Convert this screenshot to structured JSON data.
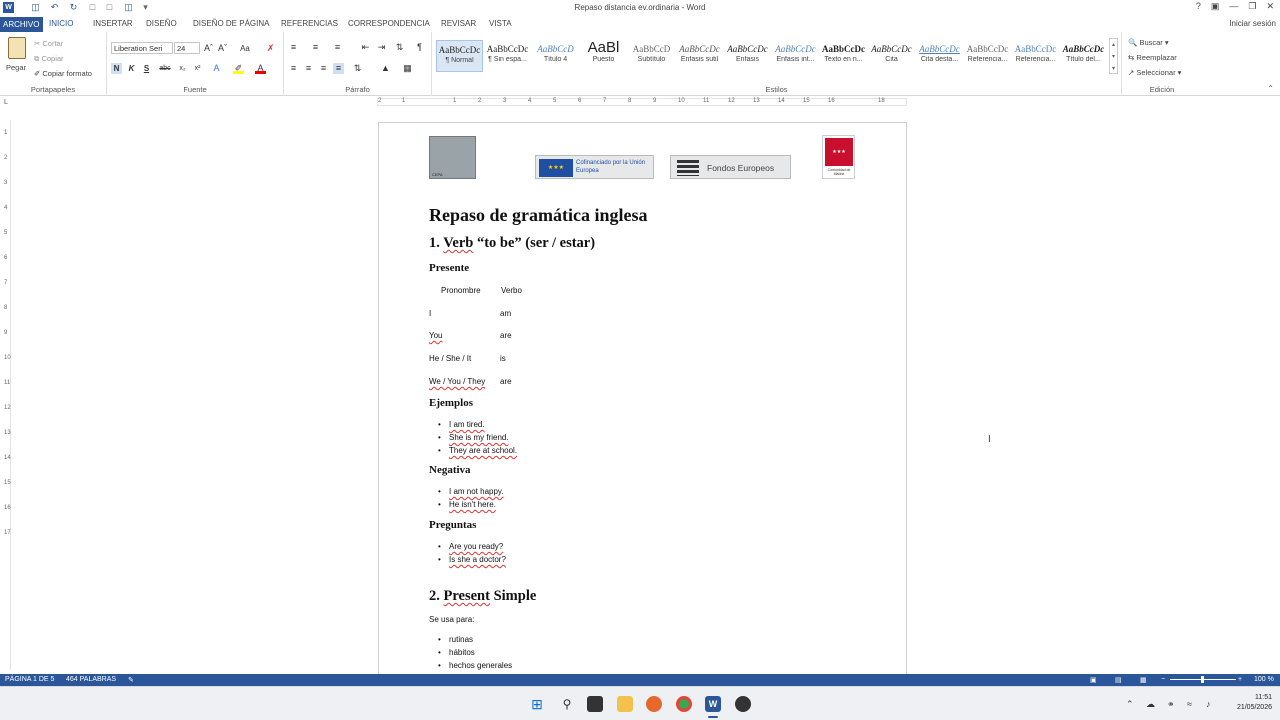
{
  "window": {
    "title": "Repaso distancia ev.ordinaria - Word",
    "help": "?",
    "signin": "Iniciar sesión"
  },
  "tabs": [
    {
      "label": "ARCHIVO"
    },
    {
      "label": "INICIO"
    },
    {
      "label": "INSERTAR"
    },
    {
      "label": "DISEÑO"
    },
    {
      "label": "DISEÑO DE PÁGINA"
    },
    {
      "label": "REFERENCIAS"
    },
    {
      "label": "CORRESPONDENCIA"
    },
    {
      "label": "REVISAR"
    },
    {
      "label": "VISTA"
    }
  ],
  "ribbon": {
    "clipboard": {
      "paste": "Pegar",
      "cut": "Cortar",
      "copy": "Copiar",
      "format_painter": "Copiar formato",
      "label": "Portapapeles"
    },
    "font": {
      "name": "Liberation Seri",
      "size": "24",
      "label": "Fuente",
      "bold": "N",
      "italic": "K",
      "underline": "S",
      "strike": "abc",
      "sub": "x₂",
      "sup": "x²",
      "case": "Aa"
    },
    "paragraph": {
      "label": "Párrafo"
    },
    "styles": {
      "label": "Estilos",
      "items": [
        {
          "preview": "AaBbCcDc",
          "name": "¶ Normal"
        },
        {
          "preview": "AaBbCcDc",
          "name": "¶ Sin espa..."
        },
        {
          "preview": "AaBbCcD",
          "name": "Título 4"
        },
        {
          "preview": "AaBl",
          "name": "Puesto"
        },
        {
          "preview": "AaBbCcD",
          "name": "Subtítulo"
        },
        {
          "preview": "AaBbCcDc",
          "name": "Énfasis sutil"
        },
        {
          "preview": "AaBbCcDc",
          "name": "Énfasis"
        },
        {
          "preview": "AaBbCcDc",
          "name": "Énfasis int..."
        },
        {
          "preview": "AaBbCcDc",
          "name": "Texto en n..."
        },
        {
          "preview": "AaBbCcDc",
          "name": "Cita"
        },
        {
          "preview": "AaBbCcDc",
          "name": "Cita desta..."
        },
        {
          "preview": "AaBbCcDc",
          "name": "Referencia..."
        },
        {
          "preview": "AaBbCcDc",
          "name": "Referencia..."
        },
        {
          "preview": "AaBbCcDc",
          "name": "Título del..."
        }
      ]
    },
    "editing": {
      "find": "Buscar",
      "replace": "Reemplazar",
      "select": "Seleccionar",
      "label": "Edición"
    }
  },
  "ruler": {
    "marks": [
      "2",
      "1",
      "1",
      "2",
      "3",
      "4",
      "5",
      "6",
      "7",
      "8",
      "9",
      "10",
      "11",
      "12",
      "13",
      "14",
      "15",
      "16",
      "18"
    ]
  },
  "vruler": {
    "marks": [
      "1",
      "2",
      "3",
      "4",
      "5",
      "6",
      "7",
      "8",
      "9",
      "10",
      "11",
      "12",
      "13",
      "14",
      "15",
      "16",
      "17"
    ]
  },
  "document": {
    "logos": {
      "left": "CEPA",
      "eu": "Cofinanciado por la Unión Europea",
      "funds": "Fondos Europeos",
      "madrid": "Comunidad de Madrid"
    },
    "title": "Repaso de gramática inglesa",
    "section1": {
      "num": "1.",
      "title_word": "Verb",
      "title_rest": " “to be” (ser / estar)"
    },
    "presente": "Presente",
    "table": {
      "headers": [
        "Pronombre",
        "Verbo"
      ],
      "rows": [
        {
          "pron": "I",
          "verb": "am"
        },
        {
          "pron": "You",
          "verb": "are"
        },
        {
          "pron": "He / She / It",
          "verb": "is"
        },
        {
          "pron": "We / You / They",
          "verb": "are"
        }
      ]
    },
    "ejemplos": "Ejemplos",
    "ejemplos_items": [
      "I am tired.",
      "She is my friend.",
      "They are at school."
    ],
    "negativa": "Negativa",
    "negativa_items": [
      "I am not happy.",
      "He isn't here."
    ],
    "preguntas": "Preguntas",
    "preguntas_items": [
      "Are you ready?",
      "Is she a doctor?"
    ],
    "section2": {
      "num": "2.",
      "title_word": "Present",
      "title_rest": " Simple"
    },
    "se_usa": "Se usa para:",
    "uses": [
      "rutinas",
      "hábitos",
      "hechos generales"
    ]
  },
  "statusbar": {
    "page": "PÁGINA 1 DE 5",
    "words": "464 PALABRAS",
    "zoom": "100 %"
  },
  "taskbar": {
    "time": "11:51",
    "date": "21/05/2026"
  },
  "colors": {
    "accent": "#2b579a",
    "squiggle": "#d33333"
  }
}
